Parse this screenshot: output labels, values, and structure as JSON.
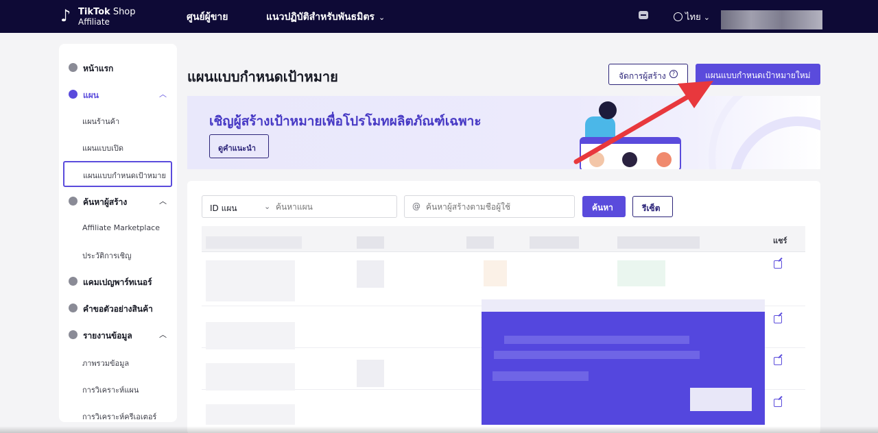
{
  "topbar": {
    "logo_line1_brand": "TikTok",
    "logo_line1_shop": " Shop",
    "logo_line2": "Affiliate",
    "nav_seller_center": "ศูนย์ผู้ขาย",
    "nav_partner_guide": "แนวปฏิบัติสำหรับพันธมิตร",
    "language": "ไทย"
  },
  "sidebar": {
    "home": "หน้าแรก",
    "plans": "แผน",
    "plans_sub": [
      "แผนร้านค้า",
      "แผนแบบเปิด",
      "แผนแบบกำหนดเป้าหมาย"
    ],
    "find_creators": "ค้นหาผู้สร้าง",
    "find_creators_sub": [
      "Affiliate Marketplace",
      "ประวัติการเชิญ"
    ],
    "partner_campaign": "แคมเปญพาร์ทเนอร์",
    "sample_requests": "คำขอตัวอย่างสินค้า",
    "data_reports": "รายงานข้อมูล",
    "data_reports_sub": [
      "ภาพรวมข้อมูล",
      "การวิเคราะห์แผน",
      "การวิเคราะห์ครีเอเตอร์"
    ]
  },
  "main": {
    "title": "แผนแบบกำหนดเป้าหมาย",
    "manage_creators_button": "จัดการผู้สร้าง",
    "new_plan_button": "แผนแบบกำหนดเป้าหมายใหม่",
    "banner_title": "เชิญผู้สร้างเป้าหมายเพื่อโปรโมทผลิตภัณฑ์เฉพาะ",
    "banner_button": "ดูคำแนะนำ"
  },
  "filters": {
    "select_value": "ID แผน",
    "plan_placeholder": "ค้นหาแผน",
    "creator_prefix": "@",
    "creator_placeholder": "ค้นหาผู้สร้างตามชื่อผู้ใช้",
    "search_button": "ค้นหา",
    "reset_button": "รีเซ็ต"
  },
  "table": {
    "share_column": "แชร์"
  },
  "colors": {
    "topbar": "#0e0a36",
    "accent": "#5a4bdc",
    "annotation": "#e8383d"
  }
}
